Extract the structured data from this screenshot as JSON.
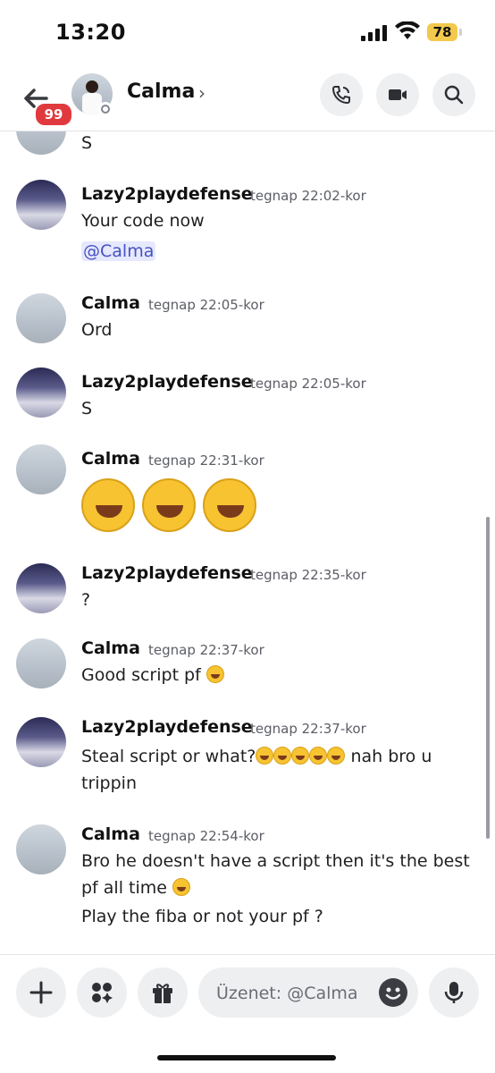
{
  "status_bar": {
    "time": "13:20",
    "battery": "78"
  },
  "header": {
    "back_badge": "99",
    "name": "Calma",
    "chevron": "›"
  },
  "messages": [
    {
      "continuation": "S"
    },
    {
      "author": "Lazy2playdefense",
      "time": "tegnap 22:02-kor",
      "lines": [
        "Your code now"
      ],
      "mention": "@Calma"
    },
    {
      "author": "Calma",
      "time": "tegnap 22:05-kor",
      "lines": [
        "Ord"
      ]
    },
    {
      "author": "Lazy2playdefense",
      "time": "tegnap 22:05-kor",
      "lines": [
        "S"
      ]
    },
    {
      "author": "Calma",
      "time": "tegnap 22:31-kor",
      "emoji": "rolling-on-floor-laughing x3"
    },
    {
      "author": "Lazy2playdefense",
      "time": "tegnap 22:35-kor",
      "lines": [
        "?"
      ]
    },
    {
      "author": "Calma",
      "time": "tegnap 22:37-kor",
      "lines": [
        "Good script pf"
      ]
    },
    {
      "author": "Lazy2playdefense",
      "time": "tegnap 22:37-kor",
      "lines": [
        "Steal script or what?",
        "nah bro u",
        "trippin"
      ]
    },
    {
      "author": "Calma",
      "time": "tegnap 22:54-kor",
      "lines": [
        "Bro he doesn't have a script then it's the best",
        "pf all time",
        "Play the fiba or not your pf ?"
      ]
    }
  ],
  "composer": {
    "placeholder": "Üzenet: @Calma"
  }
}
